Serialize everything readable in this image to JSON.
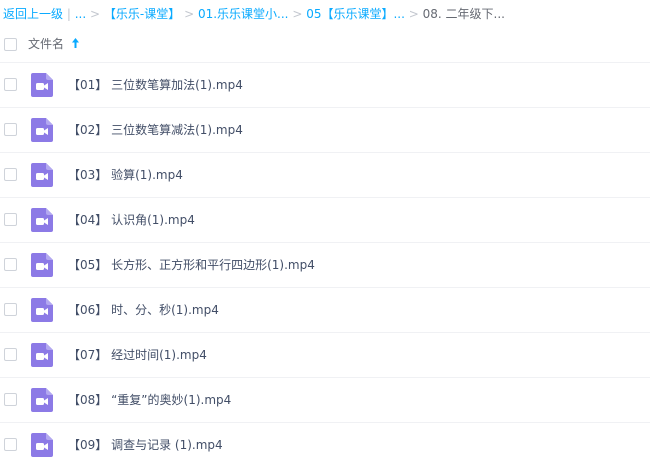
{
  "breadcrumb": {
    "back_label": "返回上一级",
    "divider": "|",
    "ellipsis": "...",
    "sep": ">",
    "items": [
      "【乐乐-课堂】",
      "01.乐乐课堂小...",
      "05【乐乐课堂】...",
      "08. 二年级下..."
    ]
  },
  "header": {
    "label": "文件名",
    "sort_icon": "arrow-up-icon"
  },
  "file_icon": "video-file-icon",
  "file_icon_color": "#8c7ae6",
  "accent_color": "#09aaff",
  "files": [
    {
      "name": "【01】 三位数笔算加法(1).mp4"
    },
    {
      "name": "【02】 三位数笔算减法(1).mp4"
    },
    {
      "name": "【03】 验算(1).mp4"
    },
    {
      "name": "【04】 认识角(1).mp4"
    },
    {
      "name": "【05】 长方形、正方形和平行四边形(1).mp4"
    },
    {
      "name": "【06】 时、分、秒(1).mp4"
    },
    {
      "name": "【07】 经过时间(1).mp4"
    },
    {
      "name": "【08】 “重复”的奥妙(1).mp4"
    },
    {
      "name": "【09】 调查与记录 (1).mp4"
    }
  ]
}
